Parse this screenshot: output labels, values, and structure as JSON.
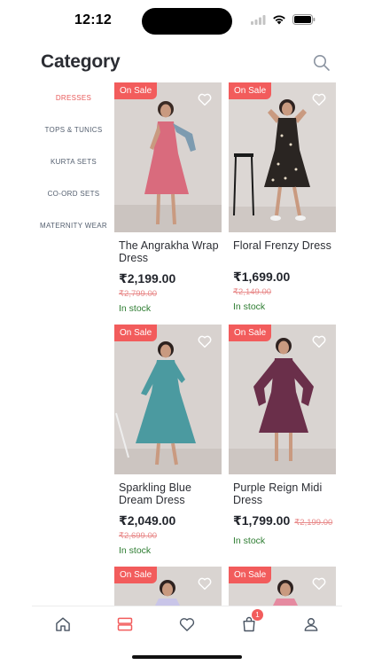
{
  "status_bar": {
    "time": "12:12"
  },
  "header": {
    "title": "Category"
  },
  "sidebar": {
    "items": [
      {
        "label": "DRESSES",
        "active": true
      },
      {
        "label": "TOPS & TUNICS",
        "active": false
      },
      {
        "label": "KURTA SETS",
        "active": false
      },
      {
        "label": "CO-ORD SETS",
        "active": false
      },
      {
        "label": "MATERNITY WEAR",
        "active": false
      }
    ]
  },
  "products": [
    {
      "badge": "On Sale",
      "name": "The Angrakha Wrap Dress",
      "price": "₹2,199.00",
      "mrp": "₹2,799.00",
      "stock": "In stock",
      "dress_color": "#d96b7d"
    },
    {
      "badge": "On Sale",
      "name": "Floral Frenzy Dress",
      "price": "₹1,699.00",
      "mrp": "₹2,149.00",
      "stock": "In stock",
      "dress_color": "#2a2522"
    },
    {
      "badge": "On Sale",
      "name": "Sparkling Blue Dream Dress",
      "price": "₹2,049.00",
      "mrp": "₹2,699.00",
      "stock": "In stock",
      "dress_color": "#4b9aa0"
    },
    {
      "badge": "On Sale",
      "name": "Purple Reign Midi Dress",
      "price": "₹1,799.00",
      "mrp": "₹2,199.00",
      "stock": "In stock",
      "dress_color": "#6a2f4a"
    },
    {
      "badge": "On Sale",
      "dress_color": "#c9c5e8"
    },
    {
      "badge": "On Sale",
      "dress_color": "#e58aa0"
    }
  ],
  "bottom_nav": {
    "items": [
      "home-icon",
      "category-icon",
      "heart-icon",
      "cart-icon",
      "profile-icon"
    ],
    "cart_count": "1"
  },
  "colors": {
    "accent": "#f25c5c",
    "stock_green": "#2e7d32",
    "strike": "#e88a8a"
  }
}
